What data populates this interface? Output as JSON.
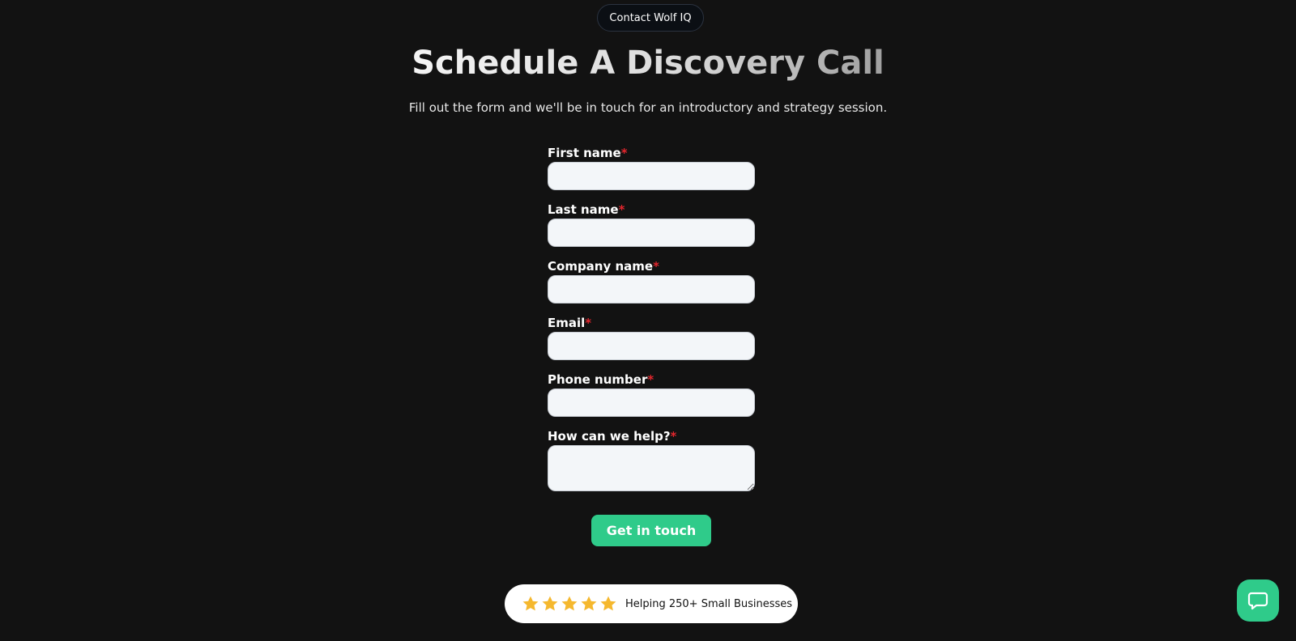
{
  "header": {
    "pill_label": "Contact Wolf IQ",
    "title": "Schedule A Discovery Call",
    "subtitle": "Fill out the form and we'll be in touch for an introductory and strategy session."
  },
  "form": {
    "required_marker": "*",
    "fields": [
      {
        "label": "First name",
        "value": "",
        "type": "text"
      },
      {
        "label": "Last name",
        "value": "",
        "type": "text"
      },
      {
        "label": "Company name",
        "value": "",
        "type": "text"
      },
      {
        "label": "Email",
        "value": "",
        "type": "email"
      },
      {
        "label": "Phone number",
        "value": "",
        "type": "tel"
      },
      {
        "label": "How can we help?",
        "value": "",
        "type": "textarea"
      }
    ],
    "submit_label": "Get in touch"
  },
  "badge": {
    "rating": 5,
    "max_rating": 5,
    "text": "Helping 250+ Small Businesses",
    "star_color": "#f5b82e"
  },
  "colors": {
    "background": "#121212",
    "accent": "#2fcb8a",
    "required": "#e3262d"
  },
  "icons": {
    "chat": "chat-bubble-icon",
    "star": "star-icon"
  }
}
